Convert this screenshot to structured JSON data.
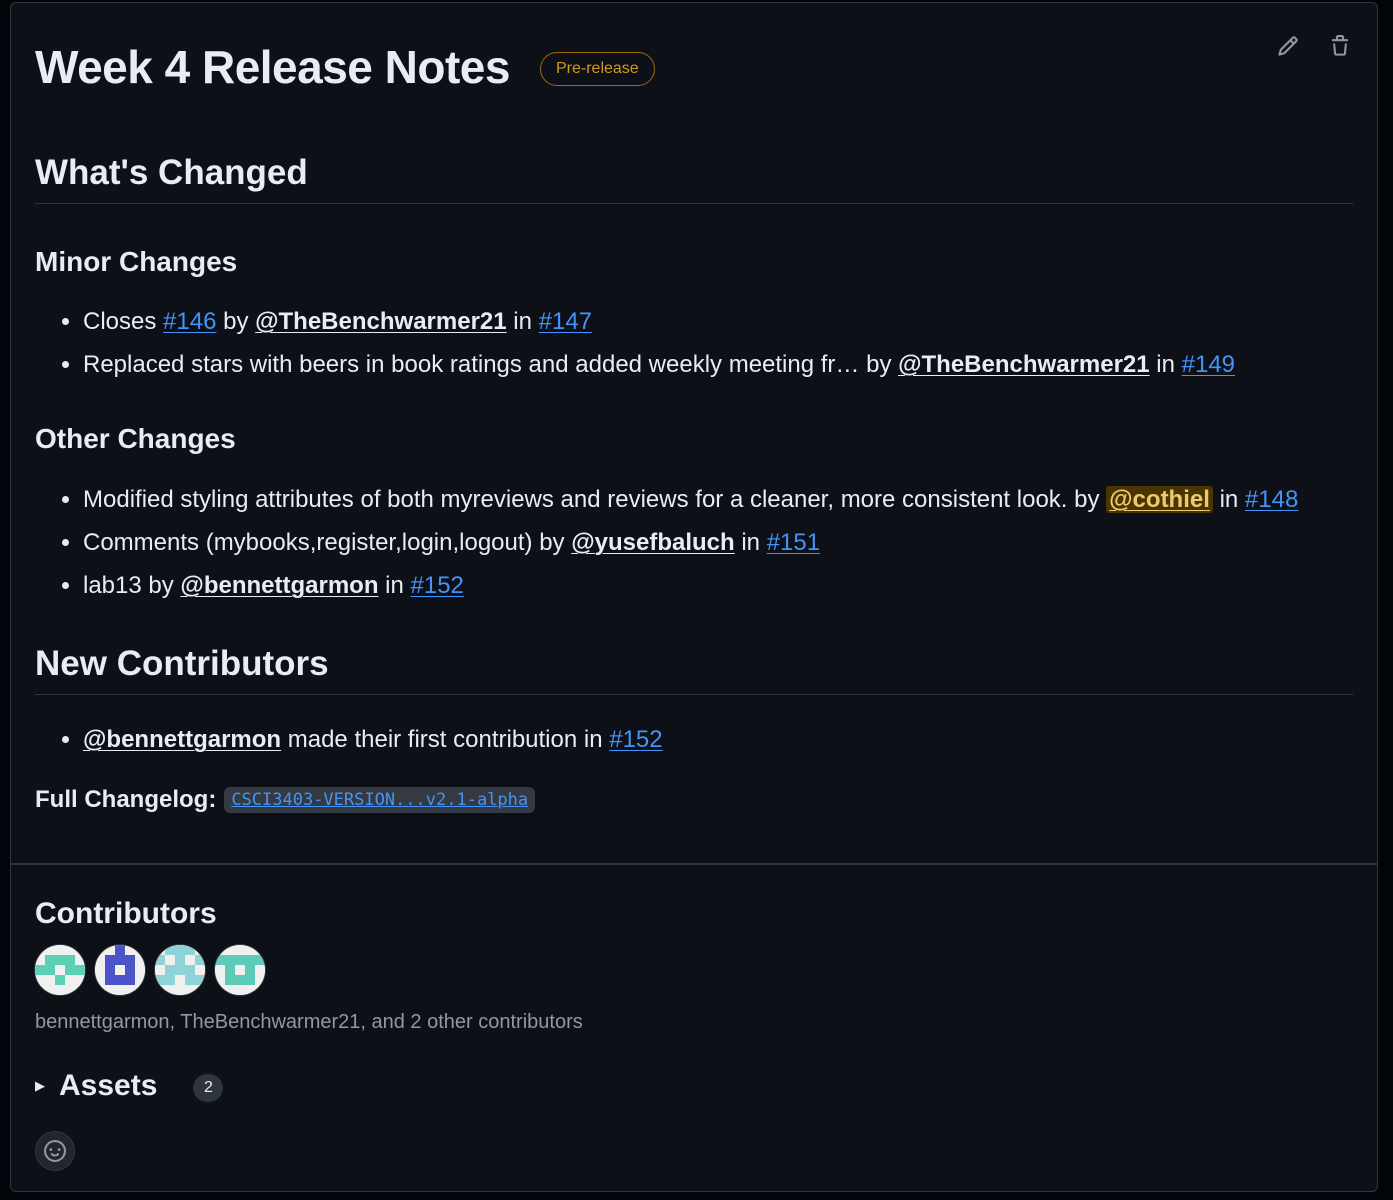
{
  "release": {
    "title": "Week 4 Release Notes",
    "badge": "Pre-release",
    "edit_icon": "pencil-icon",
    "delete_icon": "trash-icon"
  },
  "sections": {
    "whats_changed": "What's Changed",
    "minor_changes": {
      "heading": "Minor Changes",
      "items": [
        {
          "prefix": "Closes ",
          "issue": "#146",
          "by": " by ",
          "user": "@TheBenchwarmer21",
          "in": " in ",
          "pr": "#147"
        },
        {
          "prefix": "Replaced stars with beers in book ratings and added weekly meeting fr…",
          "by": " by ",
          "user": "@TheBenchwarmer21",
          "in": " in ",
          "pr": "#149"
        }
      ]
    },
    "other_changes": {
      "heading": "Other Changes",
      "items": [
        {
          "prefix": "Modified styling attributes of both myreviews and reviews for a cleaner, more consistent look.",
          "by": " by ",
          "user": "@cothiel",
          "in": " in ",
          "pr": "#148"
        },
        {
          "prefix": "Comments (mybooks,register,login,logout)",
          "by": " by ",
          "user": "@yusefbaluch",
          "in": " in ",
          "pr": "#151"
        },
        {
          "prefix": "lab13",
          "by": " by ",
          "user": "@bennettgarmon",
          "in": " in ",
          "pr": "#152"
        }
      ]
    },
    "new_contributors": {
      "heading": "New Contributors",
      "items": [
        {
          "user": "@bennettgarmon",
          "text": " made their first contribution in ",
          "pr": "#152"
        }
      ]
    },
    "full_changelog": {
      "label": "Full Changelog:",
      "link": "CSCI3403-VERSION...v2.1-alpha"
    }
  },
  "contributors": {
    "heading": "Contributors",
    "summary": "bennettgarmon, TheBenchwarmer21, and 2 other contributors",
    "avatar_colors": [
      "#5bd1b4",
      "#4b55c9",
      "#8fd3d8",
      "#5ccbb8"
    ]
  },
  "assets": {
    "label": "Assets",
    "count": "2"
  },
  "reactions": {
    "icon": "smiley-icon"
  }
}
